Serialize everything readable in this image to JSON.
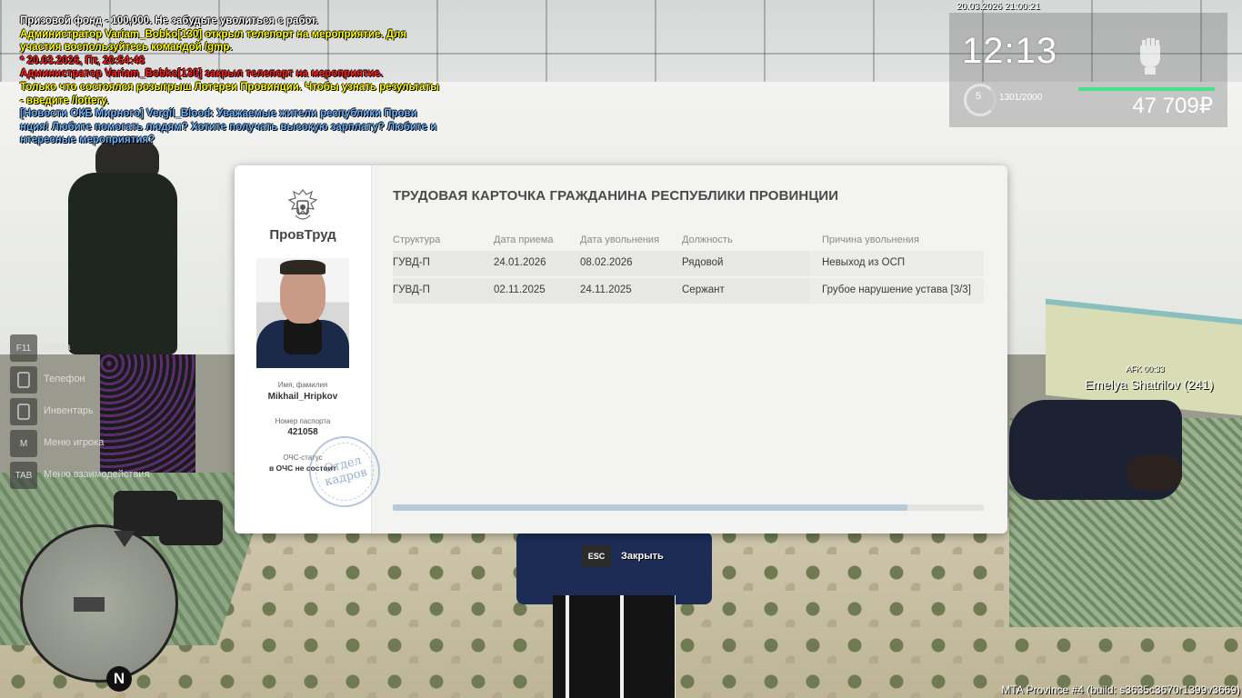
{
  "chat": [
    {
      "text": "Призовой фонд - 100,000. Не забудьте уволиться с работ.",
      "color": "white"
    },
    {
      "text": "Администратор Variam_Bobko[130] открыл телепорт на мероприятие. Для",
      "color": "yellow"
    },
    {
      "text": "участия воспользуйтесь командой /gmp.",
      "color": "yellow"
    },
    {
      "text": "* 20.03.2026, Пт, 20:54:48",
      "color": "red"
    },
    {
      "text": "Администратор Variam_Bobko[130] закрыл телепорт на мероприятие.",
      "color": "red"
    },
    {
      "text": "Только что состоялся розыгрыш Лотереи Провинции. Чтобы узнать результаты",
      "color": "yellow"
    },
    {
      "text": "- введите /lottery.",
      "color": "yellow"
    },
    {
      "text": "[Новости ОКБ Мирного] Vergil_Blood: Уважаемые жители республики Прови",
      "color": "blue"
    },
    {
      "text": "нция! Любите помогать людям? Хотите получать высокую зарплату? Любите и",
      "color": "blue"
    },
    {
      "text": "нтересные мероприятия?",
      "color": "blue"
    }
  ],
  "hud": {
    "datetime": "20.03.2026 21:00:21",
    "time": "12:13",
    "level": "5",
    "xp": "1301/2000",
    "health_fraction": 1.0,
    "money": "47 709₽"
  },
  "hints": [
    {
      "key": "F11",
      "label": "Карта"
    },
    {
      "key": "",
      "label": "Телефон"
    },
    {
      "key": "",
      "label": "Инвентарь"
    },
    {
      "key": "M",
      "label": "Меню игрока"
    },
    {
      "key": "TAB",
      "label": "Меню взаимодействия"
    }
  ],
  "minimap": {
    "north": "N"
  },
  "player_tag": {
    "afk": "AFK 00:33",
    "name": "Emelya Shatrilov (241)"
  },
  "build": "MTA Province #4 (build: s3635c3670r1399v3669)",
  "card": {
    "org": "ПровТруд",
    "title": "ТРУДОВАЯ КАРТОЧКА ГРАЖДАНИНА РЕСПУБЛИКИ ПРОВИНЦИИ",
    "name_caption": "Имя, фамилия",
    "name": "Mikhail_Hripkov",
    "passport_caption": "Номер паспорта",
    "passport": "421058",
    "ochs_caption": "ОЧС-статус",
    "ochs": "в ОЧС не состоит",
    "stamp": "Отдел кадров",
    "columns": [
      "Структура",
      "Дата приема",
      "Дата увольнения",
      "Должность",
      "Причина увольнения"
    ],
    "rows": [
      [
        "ГУВД-П",
        "24.01.2026",
        "08.02.2026",
        "Рядовой",
        "Невыход из ОСП"
      ],
      [
        "ГУВД-П",
        "02.11.2025",
        "24.11.2025",
        "Сержант",
        "Грубое нарушение устава [3/3]"
      ]
    ],
    "scroll_fraction": 0.87
  },
  "close": {
    "key": "ESC",
    "label": "Закрыть"
  }
}
